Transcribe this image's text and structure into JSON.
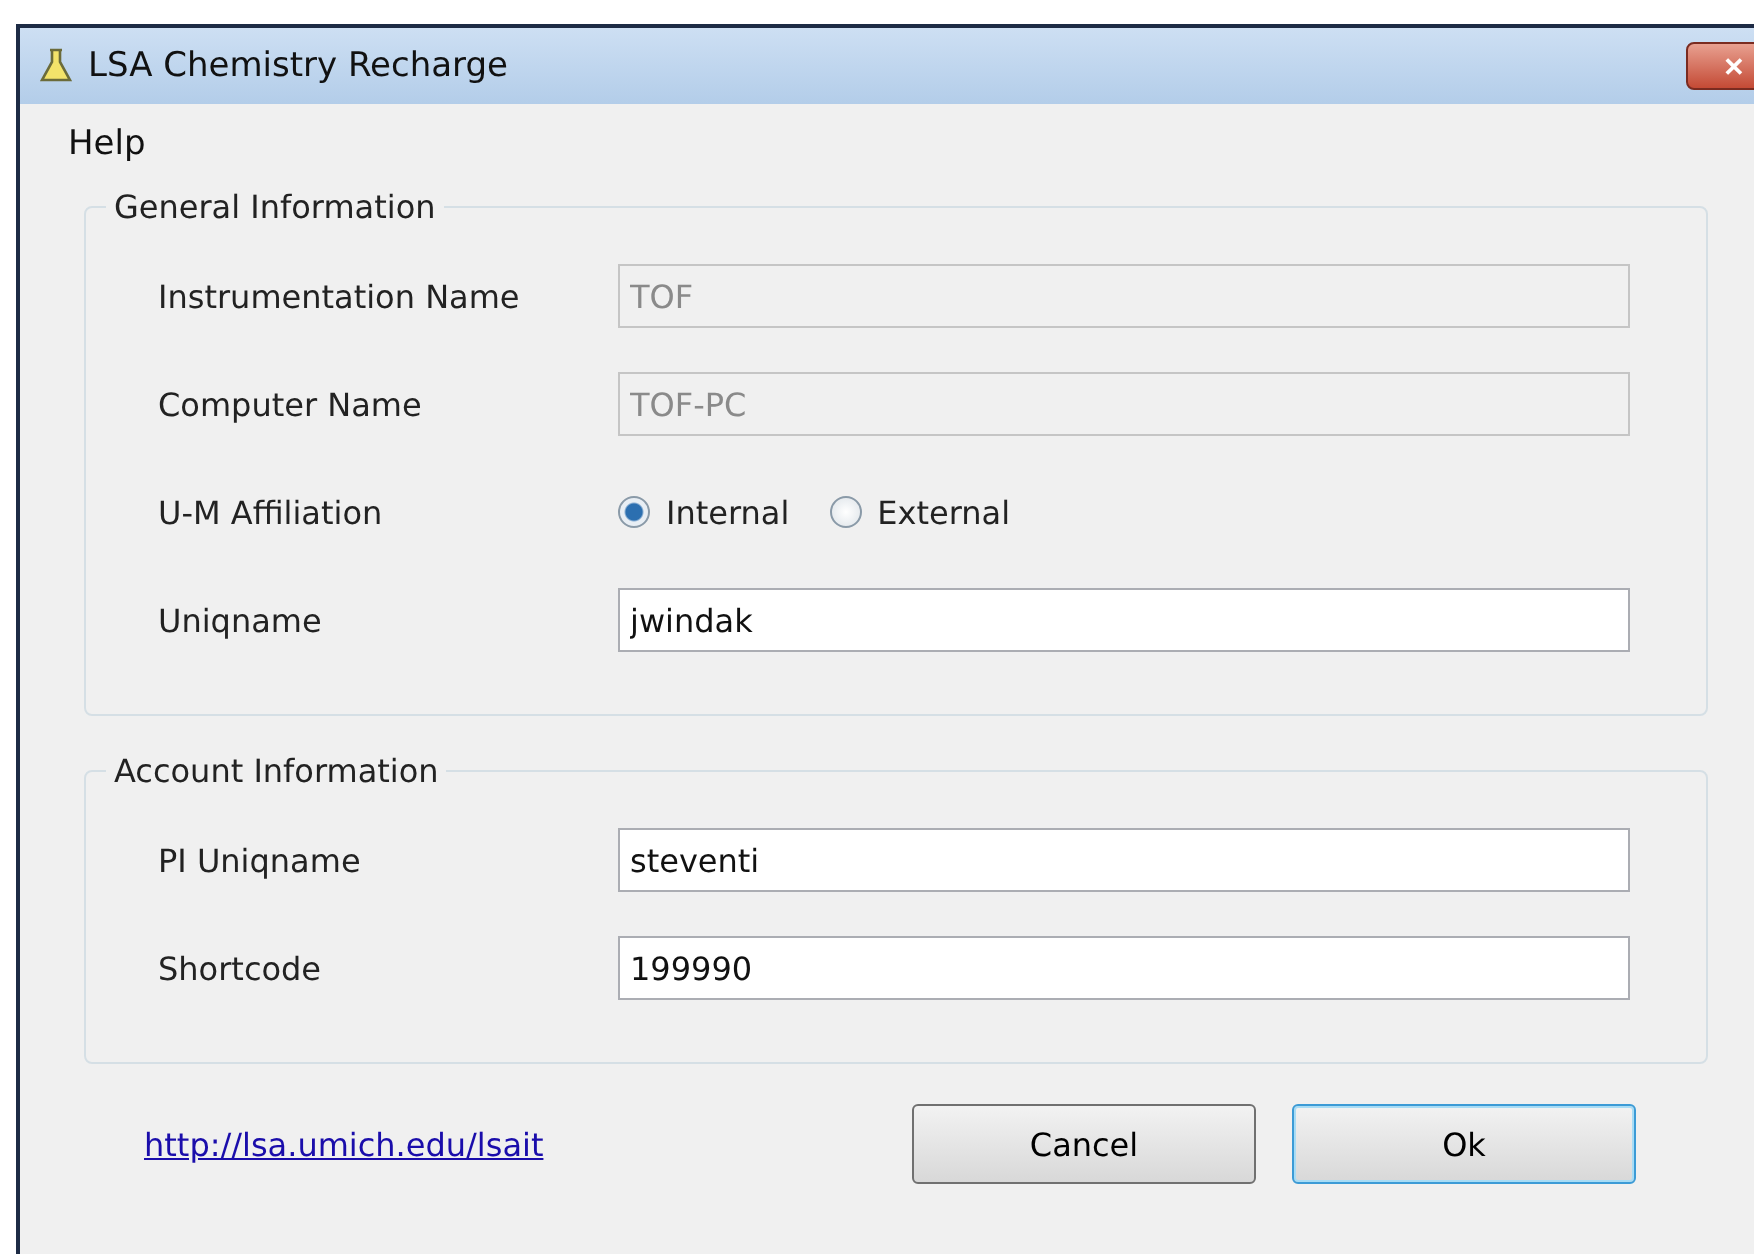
{
  "window": {
    "title": "LSA Chemistry Recharge",
    "close": "✕"
  },
  "menu": [
    {
      "label": "Help"
    }
  ],
  "groups": [
    {
      "title": "General Information",
      "rows": [
        {
          "kind": "field",
          "label": "Instrumentation Name",
          "value": "TOF",
          "disabled": true
        },
        {
          "kind": "field",
          "label": "Computer Name",
          "value": "TOF-PC",
          "disabled": true
        },
        {
          "kind": "radio",
          "label": "U-M Affiliation",
          "options": [
            {
              "label": "Internal",
              "selected": true
            },
            {
              "label": "External",
              "selected": false
            }
          ]
        },
        {
          "kind": "field",
          "label": "Uniqname",
          "value": "jwindak",
          "disabled": false
        }
      ]
    },
    {
      "title": "Account Information",
      "rows": [
        {
          "kind": "field",
          "label": "PI Uniqname",
          "value": "steventi",
          "disabled": false
        },
        {
          "kind": "field",
          "label": "Shortcode",
          "value": "199990",
          "disabled": false
        }
      ]
    }
  ],
  "link": "http://lsa.umich.edu/lsait",
  "buttons": [
    {
      "label": "Cancel",
      "default": false
    },
    {
      "label": "Ok",
      "default": true
    }
  ]
}
